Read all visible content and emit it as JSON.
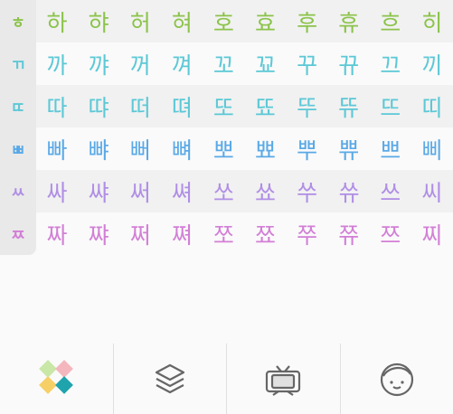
{
  "colors": {
    "green": "#8bc34a",
    "cyan": "#5cc8d6",
    "blue": "#5aa9e6",
    "purple": "#b08ee6",
    "pink": "#d27fd6",
    "dark": "#333333"
  },
  "rows": [
    {
      "head": "ㅎ",
      "color": "#8bc34a",
      "cells": [
        "하",
        "햐",
        "허",
        "혀",
        "호",
        "효",
        "후",
        "휴",
        "흐",
        "히"
      ]
    },
    {
      "head": "ㄲ",
      "color": "#5cc8d6",
      "cells": [
        "까",
        "꺄",
        "꺼",
        "껴",
        "꼬",
        "꾜",
        "꾸",
        "뀨",
        "끄",
        "끼"
      ]
    },
    {
      "head": "ㄸ",
      "color": "#5cc8d6",
      "cells": [
        "따",
        "땨",
        "떠",
        "뗘",
        "또",
        "뚀",
        "뚜",
        "뜌",
        "뜨",
        "띠"
      ]
    },
    {
      "head": "ㅃ",
      "color": "#5aa9e6",
      "cells": [
        "빠",
        "뺘",
        "뻐",
        "뼈",
        "뽀",
        "뾰",
        "뿌",
        "쀼",
        "쁘",
        "삐"
      ]
    },
    {
      "head": "ㅆ",
      "color": "#b08ee6",
      "cells": [
        "싸",
        "쌰",
        "써",
        "쎠",
        "쏘",
        "쑈",
        "쑤",
        "쓔",
        "쓰",
        "씨"
      ]
    },
    {
      "head": "ㅉ",
      "color": "#d27fd6",
      "cells": [
        "짜",
        "쨔",
        "쩌",
        "쪄",
        "쪼",
        "쬬",
        "쭈",
        "쮸",
        "쯔",
        "찌"
      ]
    }
  ],
  "tabs": [
    {
      "name": "tab-home",
      "icon": "diamond-grid-icon"
    },
    {
      "name": "tab-layers",
      "icon": "layers-icon"
    },
    {
      "name": "tab-tv",
      "icon": "tv-icon"
    },
    {
      "name": "tab-profile",
      "icon": "face-icon"
    }
  ]
}
